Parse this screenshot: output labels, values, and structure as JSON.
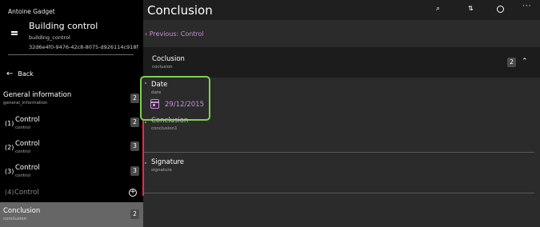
{
  "sidebar": {
    "user": "Antoine Gadget",
    "doc_title": "Building control",
    "doc_subtitle": "building_control",
    "doc_guid": "32d6e4f0-9476-42c8-8075-d926114c918f",
    "back_label": "Back",
    "items": [
      {
        "num": "",
        "title": "General information",
        "sub": "general_information",
        "count": "2"
      },
      {
        "num": "(1)",
        "title": "Control",
        "sub": "control",
        "count": "2"
      },
      {
        "num": "(2)",
        "title": "Control",
        "sub": "control",
        "count": "3"
      },
      {
        "num": "(3)",
        "title": "Control",
        "sub": "control",
        "count": "3"
      },
      {
        "num": "(4)",
        "title": "Control",
        "sub": "",
        "count": ""
      },
      {
        "num": "",
        "title": "Conclusion",
        "sub": "conclusion",
        "count": "2"
      }
    ]
  },
  "main": {
    "title": "Conclusion",
    "previous_label": "Previous: Control",
    "section": {
      "title": "Coclusion",
      "sub": "coclusion",
      "count": "2"
    },
    "fields": [
      {
        "title": "Date",
        "sub": "date",
        "value": "29/12/2015"
      },
      {
        "title": "Conclusion",
        "sub": "conclusion1"
      },
      {
        "title": "Signature",
        "sub": "signature"
      }
    ]
  },
  "colors": {
    "accent": "#c790d6",
    "highlight": "#7fd050",
    "required_bar": "#e0303f"
  }
}
